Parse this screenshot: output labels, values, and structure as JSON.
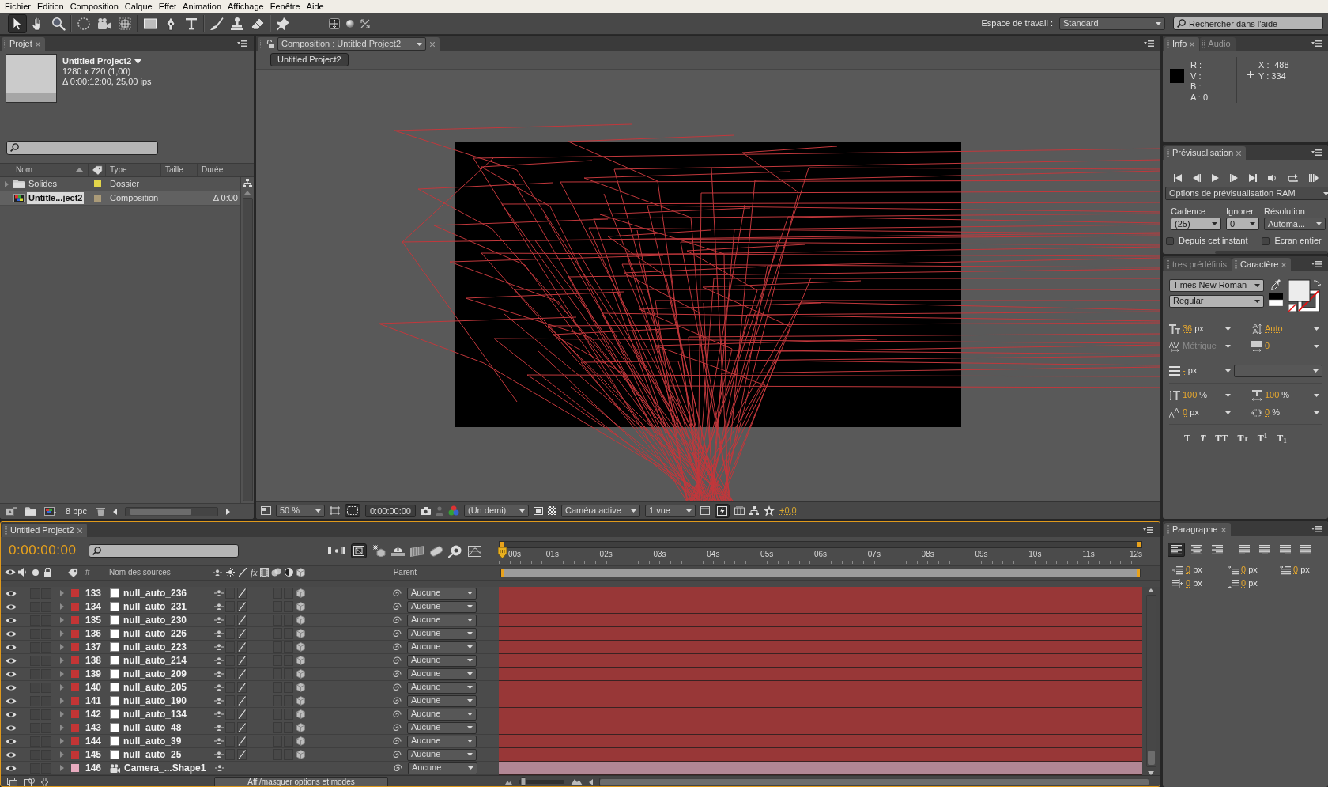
{
  "menu": [
    "Fichier",
    "Edition",
    "Composition",
    "Calque",
    "Effet",
    "Animation",
    "Affichage",
    "Fenêtre",
    "Aide"
  ],
  "tools": [
    {
      "kind": "selection",
      "selected": true
    },
    {
      "kind": "hand",
      "selected": false
    },
    {
      "kind": "zoom",
      "selected": false
    },
    {
      "kind": "rotation",
      "selected": false
    },
    {
      "kind": "camera",
      "selected": false
    },
    {
      "kind": "pan_behind",
      "selected": false
    },
    {
      "kind": "rectangle",
      "selected": false
    },
    {
      "kind": "pen",
      "selected": false
    },
    {
      "kind": "text",
      "selected": false
    },
    {
      "kind": "brush",
      "selected": false
    },
    {
      "kind": "stamp",
      "selected": false
    },
    {
      "kind": "eraser",
      "selected": false
    },
    {
      "kind": "pin",
      "selected": false
    }
  ],
  "workspace": {
    "label": "Espace de travail :",
    "value": "Standard"
  },
  "help_search": {
    "placeholder": "Rechercher dans l'aide"
  },
  "project": {
    "tab": "Projet",
    "title": "Untitled Project2",
    "details": [
      "1280 x 720 (1,00)",
      "Δ 0:00:12:00, 25,00 ips"
    ],
    "columns": [
      "Nom",
      "Type",
      "Taille",
      "Durée"
    ],
    "items": [
      {
        "kind": "folder",
        "name": "Solides",
        "color": "#e2d54a",
        "type": "Dossier",
        "selected": false
      },
      {
        "kind": "composition",
        "name": "Untitle...ject2",
        "color": "#ab9b78",
        "type": "Composition",
        "duration": "Δ 0:00",
        "selected": true
      }
    ],
    "bit_depth": "8 bpc"
  },
  "composition": {
    "tab": "Composition : Untitled Project2",
    "breadcrumb": "Untitled Project2",
    "zoom": "50 %",
    "mask_visibility_on": true,
    "timecode": "0:00:00:00",
    "snapshot_view_disabled": true,
    "resolution": "(Un demi)",
    "camera": "Caméra active",
    "views": "1 vue",
    "fast_previews_on": true,
    "exposure": "+0,0"
  },
  "info": {
    "tabs": [
      {
        "label": "Info",
        "selected": true
      },
      {
        "label": "Audio",
        "selected": false
      }
    ],
    "channels": [
      "R :",
      "V :",
      "B :",
      "A : 0"
    ],
    "coordinates": [
      "X : -488",
      "Y : 334"
    ]
  },
  "preview": {
    "tab": "Prévisualisation",
    "options": "Options de prévisualisation RAM",
    "fields": [
      {
        "label": "Cadence",
        "value": "(25)"
      },
      {
        "label": "Ignorer",
        "value": "0"
      },
      {
        "label": "Résolution",
        "value": "Automa..."
      }
    ],
    "checkboxes": [
      {
        "label": "Depuis cet instant",
        "checked": false
      },
      {
        "label": "Ecran entier",
        "checked": false
      }
    ]
  },
  "character": {
    "tabs": [
      {
        "label": "tres prédéfinis",
        "selected": false
      },
      {
        "label": "Caractère",
        "selected": true
      }
    ],
    "font": "Times New Roman",
    "style": "Regular",
    "metrics": [
      {
        "kind": "size",
        "value": "36",
        "unit": "px",
        "disabled": false
      },
      {
        "kind": "leading",
        "value": "Auto",
        "disabled": false
      },
      {
        "kind": "kerning",
        "value": "Métrique",
        "disabled": true
      },
      {
        "kind": "tracking",
        "value": "0",
        "disabled": false
      },
      {
        "kind": "stroke",
        "value": "-",
        "unit": "px",
        "disabled": false
      },
      {
        "kind": "vertical_scale",
        "value": "100",
        "unit": "%",
        "disabled": false
      },
      {
        "kind": "horizontal_scale",
        "value": "100",
        "unit": "%",
        "disabled": false
      },
      {
        "kind": "baseline",
        "value": "0",
        "unit": "px",
        "disabled": false
      },
      {
        "kind": "tsume",
        "value": "0",
        "unit": "%",
        "disabled": false
      }
    ],
    "type_styles": [
      {
        "kind": "bold",
        "label": "T"
      },
      {
        "kind": "italic",
        "label": "T"
      },
      {
        "kind": "all_caps",
        "label": "TT"
      },
      {
        "kind": "small_caps",
        "label": "Tt"
      },
      {
        "kind": "superscript",
        "label": "T$^{1}$"
      },
      {
        "kind": "subscript",
        "label": "T$_{1}$"
      }
    ]
  },
  "paragraph": {
    "tab": "Paragraphe",
    "alignments": [
      {
        "kind": "left",
        "selected": true
      },
      {
        "kind": "center",
        "selected": false
      },
      {
        "kind": "right",
        "selected": false
      },
      {
        "kind": "justify_left",
        "selected": false
      },
      {
        "kind": "justify_center",
        "selected": false
      },
      {
        "kind": "justify_right",
        "selected": false
      },
      {
        "kind": "justify_all",
        "selected": false
      }
    ],
    "spacing": [
      {
        "kind": "indent_left",
        "value": "0",
        "unit": "px"
      },
      {
        "kind": "space_before",
        "value": "0",
        "unit": "px"
      },
      {
        "kind": "indent_first_line",
        "value": "0",
        "unit": "px"
      },
      {
        "kind": "indent_right",
        "value": "0",
        "unit": "px"
      },
      {
        "kind": "space_after",
        "value": "0",
        "unit": "px"
      }
    ]
  },
  "timeline": {
    "tab": "Untitled Project2",
    "timecode": "0:00:00:00",
    "draft_3d_on": true,
    "number_header": "#",
    "name_header": "Nom des sources",
    "effects_header": "fx",
    "parent_header": "Parent",
    "ruler": [
      "00s",
      "01s",
      "02s",
      "03s",
      "04s",
      "05s",
      "06s",
      "07s",
      "08s",
      "09s",
      "10s",
      "11s",
      "12s"
    ],
    "layers": [
      {
        "kind": "null",
        "number": "133",
        "name": "null_auto_236",
        "color": "#c33535",
        "parent": "Aucune"
      },
      {
        "kind": "null",
        "number": "134",
        "name": "null_auto_231",
        "color": "#c33535",
        "parent": "Aucune"
      },
      {
        "kind": "null",
        "number": "135",
        "name": "null_auto_230",
        "color": "#c33535",
        "parent": "Aucune"
      },
      {
        "kind": "null",
        "number": "136",
        "name": "null_auto_226",
        "color": "#c33535",
        "parent": "Aucune"
      },
      {
        "kind": "null",
        "number": "137",
        "name": "null_auto_223",
        "color": "#c33535",
        "parent": "Aucune"
      },
      {
        "kind": "null",
        "number": "138",
        "name": "null_auto_214",
        "color": "#c33535",
        "parent": "Aucune"
      },
      {
        "kind": "null",
        "number": "139",
        "name": "null_auto_209",
        "color": "#c33535",
        "parent": "Aucune"
      },
      {
        "kind": "null",
        "number": "140",
        "name": "null_auto_205",
        "color": "#c33535",
        "parent": "Aucune"
      },
      {
        "kind": "null",
        "number": "141",
        "name": "null_auto_190",
        "color": "#c33535",
        "parent": "Aucune"
      },
      {
        "kind": "null",
        "number": "142",
        "name": "null_auto_134",
        "color": "#c33535",
        "parent": "Aucune"
      },
      {
        "kind": "null",
        "number": "143",
        "name": "null_auto_48",
        "color": "#c33535",
        "parent": "Aucune"
      },
      {
        "kind": "null",
        "number": "144",
        "name": "null_auto_39",
        "color": "#c33535",
        "parent": "Aucune"
      },
      {
        "kind": "null",
        "number": "145",
        "name": "null_auto_25",
        "color": "#c33535",
        "parent": "Aucune"
      },
      {
        "kind": "camera",
        "number": "146",
        "name": "Camera_...Shape1",
        "color": "#e8abbf",
        "parent": "Aucune"
      }
    ],
    "toggle": "Aff./masquer options et modes",
    "zoom_slider": {
      "level": 0.1
    }
  }
}
